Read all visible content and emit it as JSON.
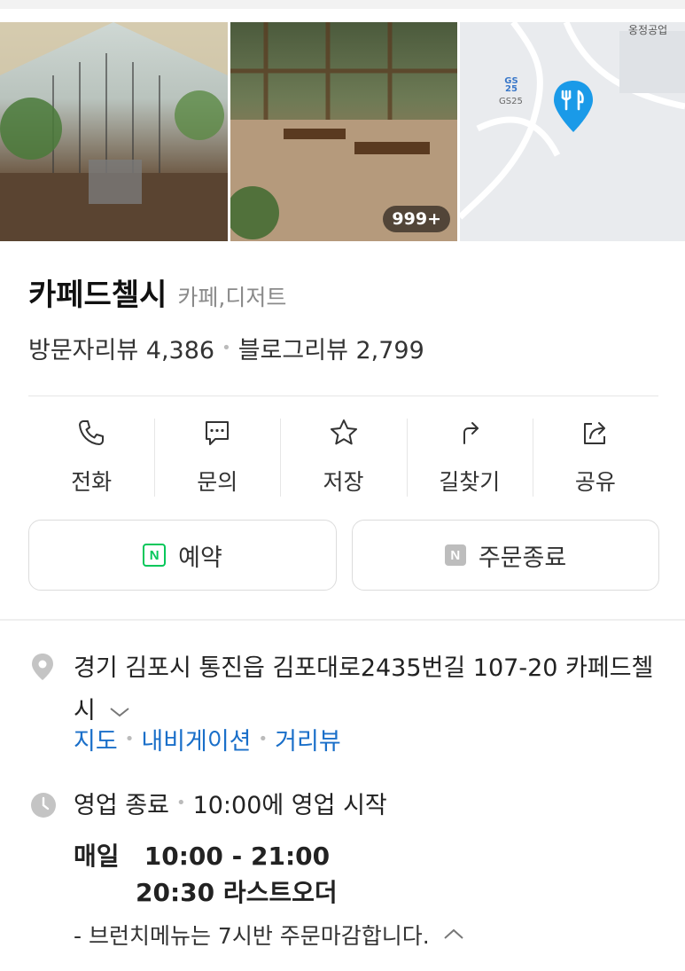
{
  "gallery": {
    "photo_count": "999+"
  },
  "map": {
    "road_label": "옹정공업",
    "poi_label": "GS25",
    "poi_mark": "GS 25",
    "pin_icon": "restaurant-pin-icon",
    "pin_color": "#1a9ae8"
  },
  "place": {
    "name": "카페드첼시",
    "category": "카페,디저트"
  },
  "reviews": {
    "visitor_label": "방문자리뷰 4,386",
    "blog_label": "블로그리뷰 2,799"
  },
  "actions": [
    {
      "label": "전화",
      "icon": "phone-icon"
    },
    {
      "label": "문의",
      "icon": "chat-icon"
    },
    {
      "label": "저장",
      "icon": "star-icon"
    },
    {
      "label": "길찾기",
      "icon": "directions-icon"
    },
    {
      "label": "공유",
      "icon": "share-icon"
    }
  ],
  "buttons": {
    "reserve": {
      "badge": "N",
      "label": "예약",
      "color": "#03c75a"
    },
    "order": {
      "badge": "N",
      "label": "주문종료",
      "color": "#bdbdbd"
    }
  },
  "address": {
    "text": "경기 김포시 통진읍 김포대로2435번길 107-20 카페드첼시",
    "links": [
      "지도",
      "내비게이션",
      "거리뷰"
    ],
    "link_color": "#1a6fc9"
  },
  "hours": {
    "status": "영업 종료",
    "next": "10:00에 영업 시작",
    "day": "매일",
    "time": "10:00 - 21:00",
    "last_order": "20:30 라스트오더",
    "note": "- 브런치메뉴는 7시반 주문마감합니다."
  }
}
